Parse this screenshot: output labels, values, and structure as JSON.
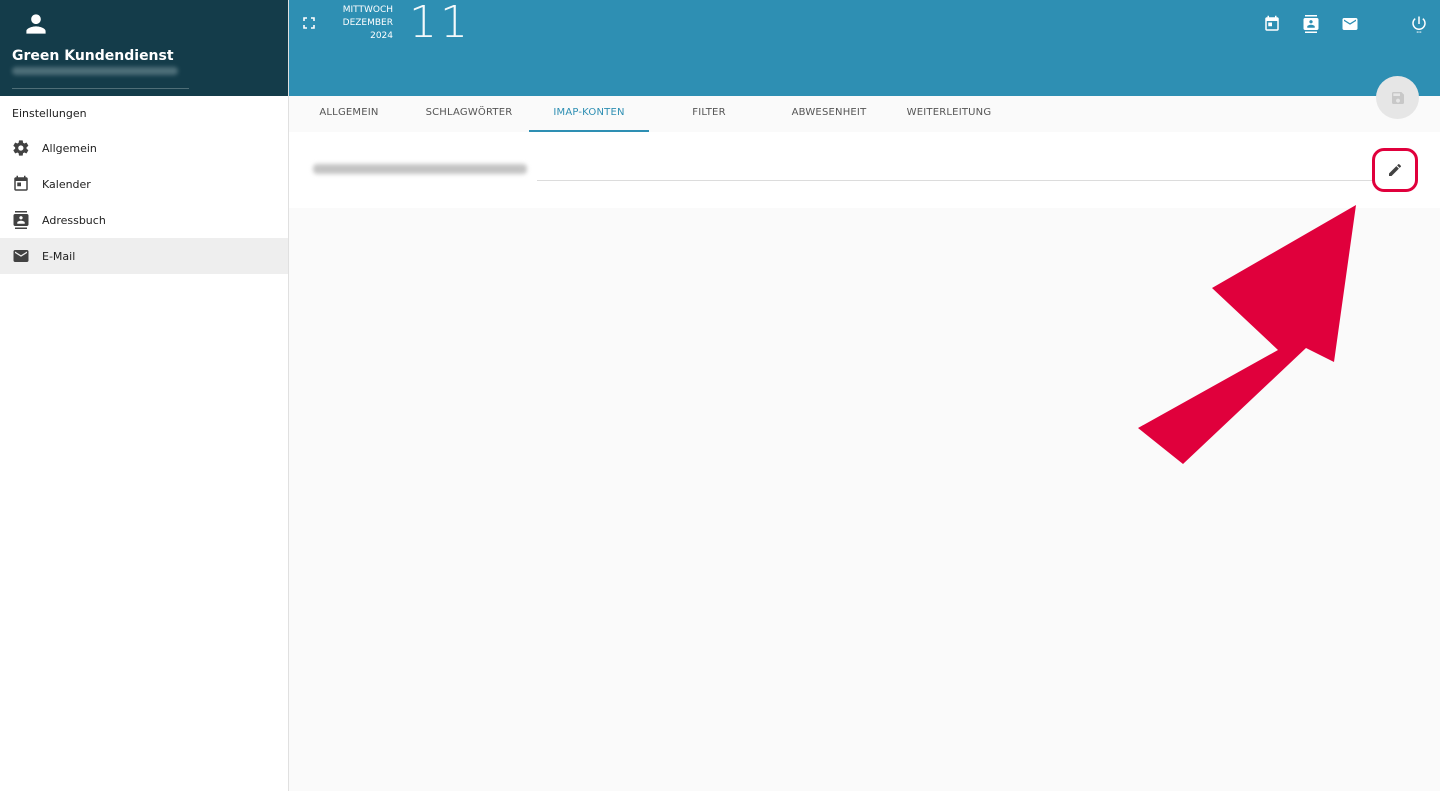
{
  "sidebar": {
    "profile_name": "Green Kundendienst",
    "section_title": "Einstellungen",
    "items": [
      {
        "label": "Allgemein",
        "icon": "gear-icon"
      },
      {
        "label": "Kalender",
        "icon": "calendar-icon"
      },
      {
        "label": "Adressbuch",
        "icon": "contacts-icon"
      },
      {
        "label": "E-Mail",
        "icon": "mail-icon",
        "active": true
      }
    ]
  },
  "header": {
    "weekday": "MITTWOCH",
    "month": "DEZEMBER",
    "year": "2024",
    "day": "11",
    "background": "#2e8fb3"
  },
  "tabs": [
    {
      "label": "ALLGEMEIN"
    },
    {
      "label": "SCHLAGWÖRTER"
    },
    {
      "label": "IMAP-KONTEN",
      "active": true
    },
    {
      "label": "FILTER"
    },
    {
      "label": "ABWESENHEIT"
    },
    {
      "label": "WEITERLEITUNG"
    }
  ],
  "colors": {
    "accent": "#2e8fb3",
    "sidebar_header": "#143c4a",
    "annotation": "#e0003c"
  }
}
